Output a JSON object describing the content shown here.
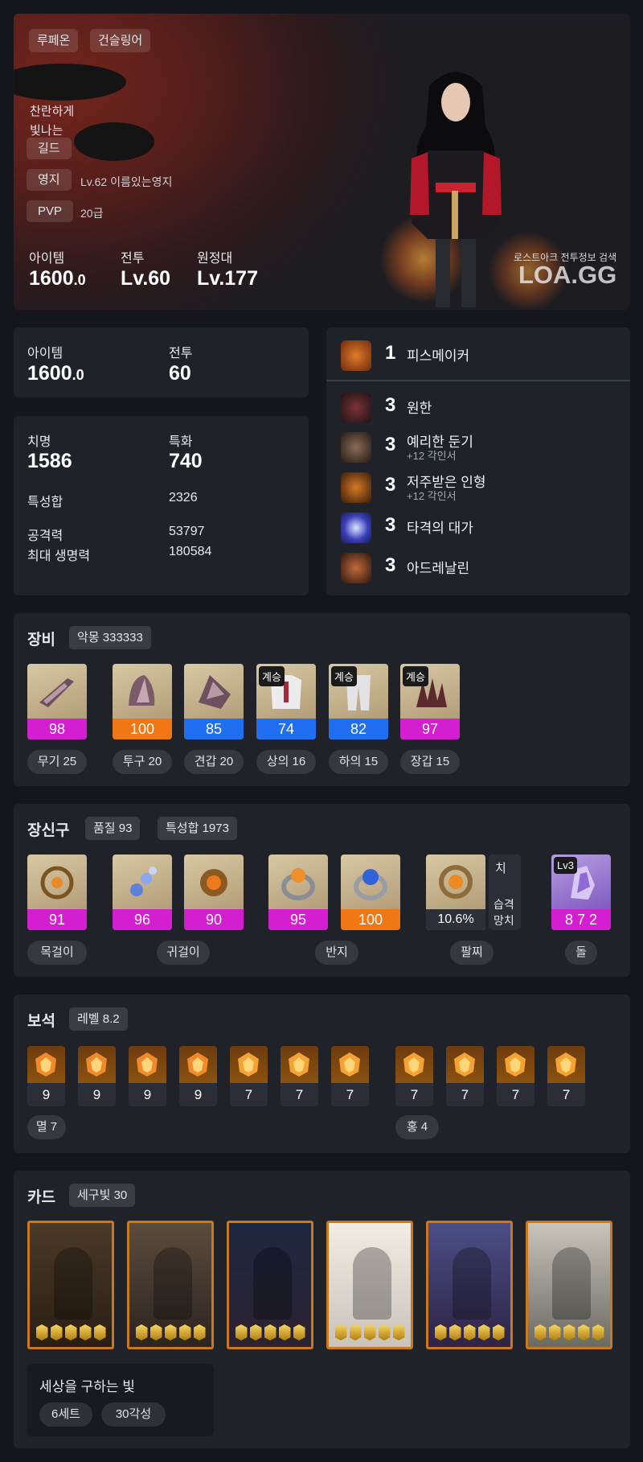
{
  "hero": {
    "server": "루페온",
    "class_name": "건슬링어",
    "title_line1": "찬란하게",
    "title_line2": "빛나는",
    "guild_label": "길드",
    "territory_label": "영지",
    "territory_value": "Lv.62 이름있는영지",
    "pvp_label": "PVP",
    "pvp_value": "20급",
    "item_label": "아이템",
    "item_value": "1600",
    "item_decimal": ".0",
    "combat_label": "전투",
    "combat_value": "Lv.60",
    "expedition_label": "원정대",
    "expedition_value": "Lv.177",
    "watermark_small": "로스트아크 전투정보 검색",
    "watermark_big": "LOA.GG"
  },
  "summary": {
    "item_label": "아이템",
    "item_value": "1600",
    "item_decimal": ".0",
    "combat_label": "전투",
    "combat_value": "60"
  },
  "stats": {
    "crit_label": "치명",
    "crit_value": "1586",
    "spec_label": "특화",
    "spec_value": "740",
    "total_label": "특성합",
    "total_value": "2326",
    "atk_label": "공격력",
    "atk_value": "53797",
    "hp_label": "최대 생명력",
    "hp_value": "180584"
  },
  "engravings": [
    {
      "level": "1",
      "name": "피스메이커",
      "sub": "",
      "color": "#b95a1c"
    },
    {
      "level": "3",
      "name": "원한",
      "sub": "",
      "color": "#4a2228"
    },
    {
      "level": "3",
      "name": "예리한 둔기",
      "sub": "+12 각인서",
      "color": "#3a2a24"
    },
    {
      "level": "3",
      "name": "저주받은 인형",
      "sub": "+12 각인서",
      "color": "#7a3d14"
    },
    {
      "level": "3",
      "name": "타격의 대가",
      "sub": "",
      "color": "#3b3fb8"
    },
    {
      "level": "3",
      "name": "아드레날린",
      "sub": "",
      "color": "#5a3020"
    }
  ],
  "equipment": {
    "title": "장비",
    "set_tag": "악몽 333333",
    "items": [
      {
        "quality": "98",
        "label": "무기 25",
        "badge": "",
        "bar_color": "#d41fd0"
      },
      {
        "quality": "100",
        "label": "투구 20",
        "badge": "",
        "bar_color": "#f07714"
      },
      {
        "quality": "85",
        "label": "견갑 20",
        "badge": "",
        "bar_color": "#1f6ff0"
      },
      {
        "quality": "74",
        "label": "상의 16",
        "badge": "계승",
        "bar_color": "#1f6ff0"
      },
      {
        "quality": "82",
        "label": "하의 15",
        "badge": "계승",
        "bar_color": "#1f6ff0"
      },
      {
        "quality": "97",
        "label": "장갑 15",
        "badge": "계승",
        "bar_color": "#d41fd0"
      }
    ]
  },
  "accessories": {
    "title": "장신구",
    "quality_tag": "품질 93",
    "stat_tag": "특성합 1973",
    "items": [
      {
        "quality": "91",
        "bar_color": "#d41fd0"
      },
      {
        "quality": "96",
        "bar_color": "#d41fd0"
      },
      {
        "quality": "90",
        "bar_color": "#d41fd0"
      },
      {
        "quality": "95",
        "bar_color": "#d41fd0"
      },
      {
        "quality": "100",
        "bar_color": "#f07714"
      }
    ],
    "bracelet_value": "10.6%",
    "bracelet_opt1": "치",
    "bracelet_opt2": "습격",
    "bracelet_opt3": "망치",
    "stone_level": "Lv3",
    "stone_value": "8 7 2",
    "labels": {
      "necklace": "목걸이",
      "earring": "귀걸이",
      "ring": "반지",
      "bracelet": "팔찌",
      "stone": "돌"
    }
  },
  "gems": {
    "title": "보석",
    "level_tag": "레벨 8.2",
    "values": [
      "9",
      "9",
      "9",
      "9",
      "7",
      "7",
      "7",
      "7",
      "7",
      "7",
      "7"
    ],
    "group1": "멸 7",
    "group2": "홍 4"
  },
  "cards": {
    "title": "카드",
    "tag": "세구빛 30",
    "set_name": "세상을 구하는 빛",
    "set_count": "6세트",
    "awaken": "30각성"
  }
}
